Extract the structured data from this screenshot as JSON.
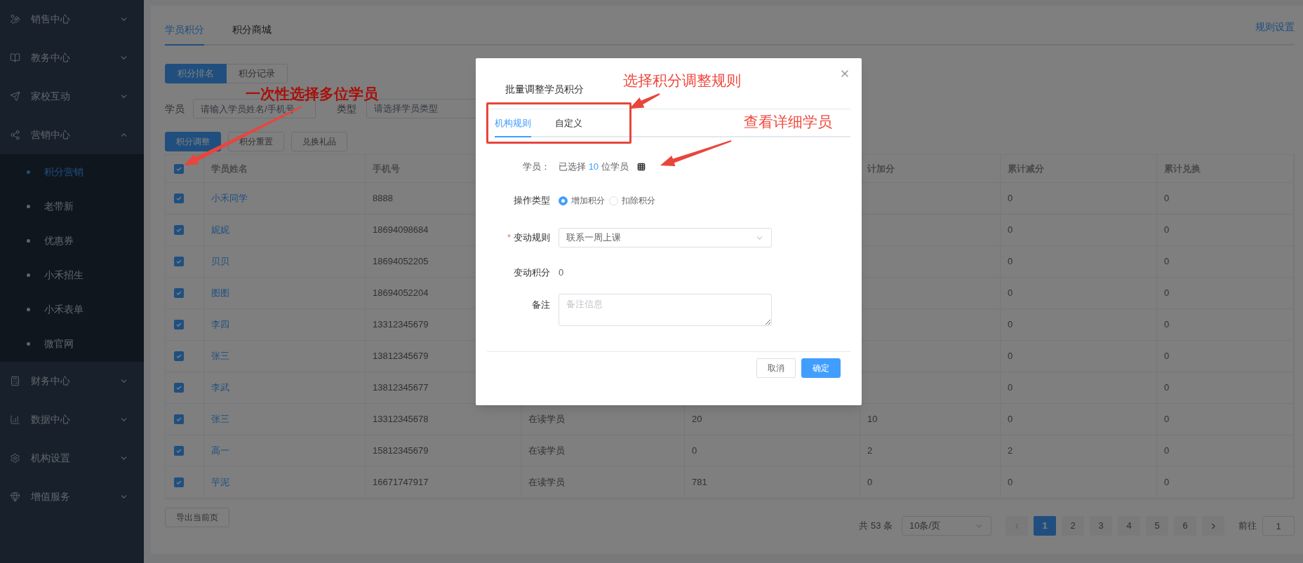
{
  "sidebar": {
    "items": [
      {
        "label": "销售中心",
        "expanded": false
      },
      {
        "label": "教务中心",
        "expanded": false
      },
      {
        "label": "家校互动",
        "expanded": false
      },
      {
        "label": "营销中心",
        "expanded": true,
        "children": [
          {
            "label": "积分营销",
            "selected": true
          },
          {
            "label": "老带新",
            "selected": false
          },
          {
            "label": "优惠券",
            "selected": false
          },
          {
            "label": "小禾招生",
            "selected": false
          },
          {
            "label": "小禾表单",
            "selected": false
          },
          {
            "label": "微官网",
            "selected": false
          }
        ]
      },
      {
        "label": "财务中心",
        "expanded": false
      },
      {
        "label": "数据中心",
        "expanded": false
      },
      {
        "label": "机构设置",
        "expanded": false
      },
      {
        "label": "增值服务",
        "expanded": false
      }
    ]
  },
  "tabs": [
    {
      "label": "学员积分",
      "selected": true
    },
    {
      "label": "积分商城",
      "selected": false
    }
  ],
  "rules_link": "规则设置",
  "view_switch": [
    {
      "label": "积分排名",
      "selected": true
    },
    {
      "label": "积分记录",
      "selected": false
    }
  ],
  "filters": {
    "student": {
      "label": "学员",
      "placeholder": "请输入学员姓名/手机号"
    },
    "type": {
      "label": "类型",
      "placeholder": "请选择学员类型"
    }
  },
  "actions": [
    {
      "label": "积分调整",
      "kind": "primary"
    },
    {
      "label": "积分重置",
      "kind": "default"
    },
    {
      "label": "兑换礼品",
      "kind": "default"
    }
  ],
  "table": {
    "all_checked": true,
    "columns": [
      {
        "label": "学员姓名"
      },
      {
        "label": "手机号"
      },
      {},
      {},
      {
        "label": "计加分"
      },
      {
        "label": "累计减分"
      },
      {
        "label": "累计兑换"
      }
    ],
    "rows": [
      {
        "checked": true,
        "cells": [
          "小禾同学",
          "8888",
          null,
          null,
          null,
          "0",
          "0"
        ]
      },
      {
        "checked": true,
        "cells": [
          "妮妮",
          "18694098684",
          null,
          null,
          null,
          "0",
          "0"
        ]
      },
      {
        "checked": true,
        "cells": [
          "贝贝",
          "18694052205",
          null,
          null,
          null,
          "0",
          "0"
        ]
      },
      {
        "checked": true,
        "cells": [
          "图图",
          "18694052204",
          null,
          null,
          null,
          "0",
          "0"
        ]
      },
      {
        "checked": true,
        "cells": [
          "李四",
          "13312345679",
          null,
          null,
          null,
          "0",
          "0"
        ]
      },
      {
        "checked": true,
        "cells": [
          "张三",
          "13812345679",
          null,
          null,
          null,
          "0",
          "0"
        ]
      },
      {
        "checked": true,
        "cells": [
          "李武",
          "13812345677",
          null,
          null,
          null,
          "0",
          "0"
        ]
      },
      {
        "checked": true,
        "cells": [
          "张三",
          "13312345678",
          "在读学员",
          "20",
          "10",
          "0",
          "0"
        ]
      },
      {
        "checked": true,
        "cells": [
          "高一",
          "15812345679",
          "在读学员",
          "0",
          "2",
          "2",
          "0"
        ]
      },
      {
        "checked": true,
        "cells": [
          "芋泥",
          "16671747917",
          "在读学员",
          "781",
          "0",
          "0",
          "0"
        ]
      }
    ]
  },
  "export_button": "导出当前页",
  "pagination": {
    "total": "共 53 条",
    "page_size": "10条/页",
    "pages": [
      {
        "label": "1",
        "selected": true
      },
      {
        "label": "2",
        "selected": false
      },
      {
        "label": "3",
        "selected": false
      },
      {
        "label": "4",
        "selected": false
      },
      {
        "label": "5",
        "selected": false
      },
      {
        "label": "6",
        "selected": false
      }
    ],
    "goto_label": "前往",
    "goto_value": "1"
  },
  "dialog": {
    "title": "批量调整学员积分",
    "tabs": [
      {
        "label": "机构规则",
        "selected": true
      },
      {
        "label": "自定义",
        "selected": false
      }
    ],
    "student": {
      "label": "学员：",
      "prefix": "已选择",
      "count": "10",
      "suffix": "位学员"
    },
    "operation": {
      "label": "操作类型",
      "options": [
        {
          "label": "增加积分",
          "selected": true
        },
        {
          "label": "扣除积分",
          "selected": false
        }
      ]
    },
    "rule": {
      "label": "变动规则",
      "required": true,
      "required_mark": "*",
      "value": "联系一周上课"
    },
    "points": {
      "label": "变动积分",
      "value": "0"
    },
    "remark": {
      "label": "备注",
      "placeholder": "备注信息"
    },
    "buttons": [
      {
        "label": "取消",
        "kind": "default"
      },
      {
        "label": "确定",
        "kind": "primary"
      }
    ]
  },
  "annotations": {
    "callouts": [
      "一次性选择多位学员",
      "选择积分调整规则",
      "查看详细学员"
    ]
  }
}
